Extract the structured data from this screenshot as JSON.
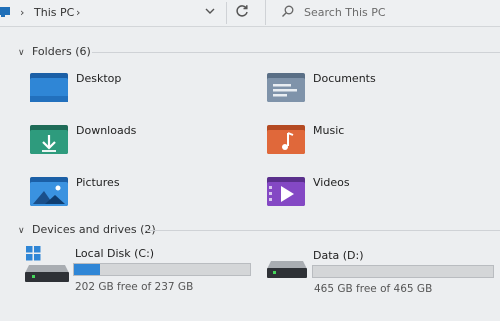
{
  "address": {
    "location_label": "This PC",
    "search_placeholder": "Search This PC"
  },
  "folders": {
    "header": "Folders (6)",
    "items": [
      {
        "label": "Desktop",
        "icon": "desktop-folder-icon"
      },
      {
        "label": "Documents",
        "icon": "documents-folder-icon"
      },
      {
        "label": "Downloads",
        "icon": "downloads-folder-icon"
      },
      {
        "label": "Music",
        "icon": "music-folder-icon"
      },
      {
        "label": "Pictures",
        "icon": "pictures-folder-icon"
      },
      {
        "label": "Videos",
        "icon": "videos-folder-icon"
      }
    ]
  },
  "drives": {
    "header": "Devices and drives (2)",
    "items": [
      {
        "name": "Local Disk (C:)",
        "free_text": "202 GB free of 237 GB",
        "used_fraction": 0.148,
        "icon": "windows-drive-icon"
      },
      {
        "name": "Data (D:)",
        "free_text": "465 GB free of 465 GB",
        "used_fraction": 0.0,
        "icon": "hard-drive-icon"
      }
    ]
  },
  "colors": {
    "accent": "#2f86d6",
    "background": "#eceef0"
  }
}
